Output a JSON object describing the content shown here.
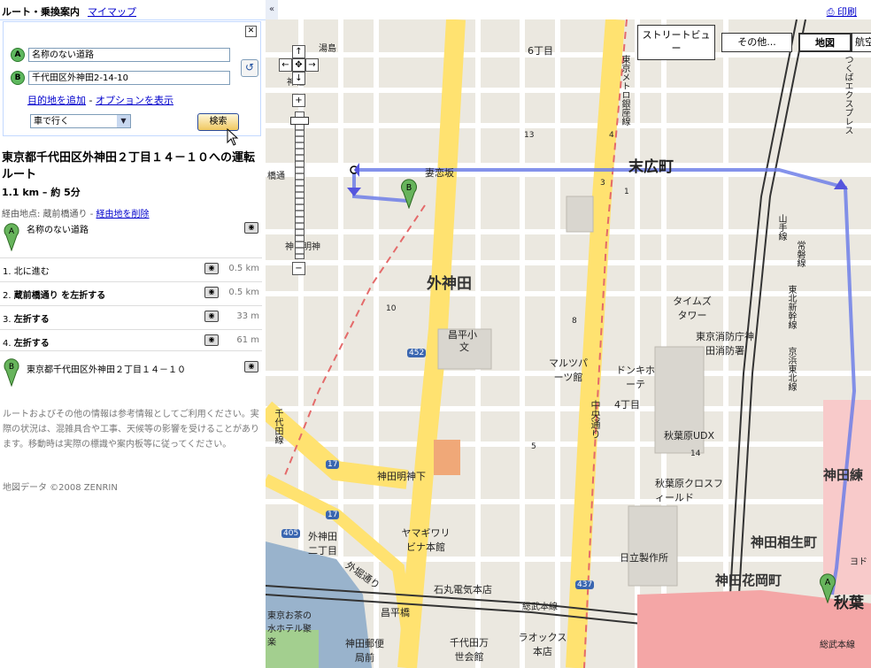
{
  "tabs": {
    "active": "ルート・乗換案内",
    "other": "マイマップ"
  },
  "panel": {
    "close_label": "✕",
    "from_marker": "A",
    "from_value": "名称のない道路",
    "to_marker": "B",
    "to_value": "千代田区外神田2-14-10",
    "add_destination": "目的地を追加",
    "separator": "-",
    "show_options": "オプションを表示",
    "travel_mode": "車で行く",
    "search_button": "検索"
  },
  "route": {
    "title": "東京都千代田区外神田２丁目１４－１０への運転ルート",
    "summary": "1.1 km – 約 5分",
    "via_label": "経由地点: 蔵前橋通り -",
    "remove_via": "経由地を削除",
    "start_name": "名称のない道路",
    "steps": [
      {
        "num": "1.",
        "text": "北に進む",
        "distance": "0.5 km"
      },
      {
        "num": "2.",
        "text": "蔵前橋通り を左折する",
        "distance": "0.5 km"
      },
      {
        "num": "3.",
        "text": "左折する",
        "distance": "33 m"
      },
      {
        "num": "4.",
        "text": "左折する",
        "distance": "61 m"
      }
    ],
    "end_name": "東京都千代田区外神田２丁目１４－１０"
  },
  "disclaimer": "ルートおよびその他の情報は参考情報としてご利用ください。実際の状況は、混雑具合や工事、天候等の影響を受けることがあります。移動時は実際の標識や案内板等に従ってください。",
  "copyright": "地図データ ©2008 ZENRIN",
  "mapbar": {
    "collapse": "«",
    "print": "印刷"
  },
  "map_controls": {
    "streetview": "ストリートビュー",
    "more": "その他...",
    "map": "地図",
    "aerial": "航空",
    "zoom_in": "+",
    "zoom_out": "−",
    "pan_up": "↑",
    "pan_down": "↓",
    "pan_left": "←",
    "pan_right": "→"
  },
  "map_labels": {
    "district_main": "外神田",
    "suehirocho": "末広町",
    "akiba": "秋葉",
    "kanda_aioi": "神田相生町",
    "kanda_hanaoka": "神田花岡町",
    "kanda_neri": "神田練",
    "myoshinzaka": "妻恋坂",
    "chome6": "6丁目",
    "chome4": "4丁目",
    "shoheisho": "昌平小",
    "bun": "文",
    "timesq": "タイムズタワー",
    "fire_dept": "東京消防庁神田消防署",
    "udx": "秋葉原UDX",
    "crossfield": "秋葉原クロスフィールド",
    "hitachi": "日立製作所",
    "donki": "ドンキホーテ",
    "marutsu": "マルツパーツ館",
    "kanda_myojin_shita": "神田明神下",
    "sotokanda2": "外神田二丁目",
    "yamagiwa": "ヤマギワリビナ本館",
    "ishimaru": "石丸電気本店",
    "laox": "ラオックス本店",
    "chiyoda_bansei": "千代田万世会館",
    "kanda_post": "神田郵便局前",
    "shoheibashi": "昌平橋",
    "sotobori": "外堀通り",
    "chuo_dori": "中央通り",
    "sobu_line": "総武本線",
    "sobu_line2": "総武本線",
    "metro_ginza": "東京メトロ銀座線",
    "yamanote": "山手線",
    "keihin": "京浜東北線",
    "joban": "常磐線",
    "tohoku_shinkansen": "東北新幹線",
    "tsukuba": "つくばエクスプレス",
    "chiyoda_line": "千代田線",
    "ochanomizu": "東京お茶の水ホテル聚楽",
    "kanda_myojin": "神田明神",
    "yushima": "湯島",
    "jinjya": "神社",
    "yodobashi": "ヨド",
    "kanda_ibashi": "橋通",
    "route452": "452",
    "route437": "437",
    "route17a": "17",
    "route17b": "17",
    "route405": "405",
    "block13": "13",
    "block3": "3",
    "block1": "1",
    "block4": "4",
    "block10": "10",
    "block14": "14",
    "block5": "5",
    "block8": "8",
    "end_marker": "B",
    "start_marker": "A"
  }
}
